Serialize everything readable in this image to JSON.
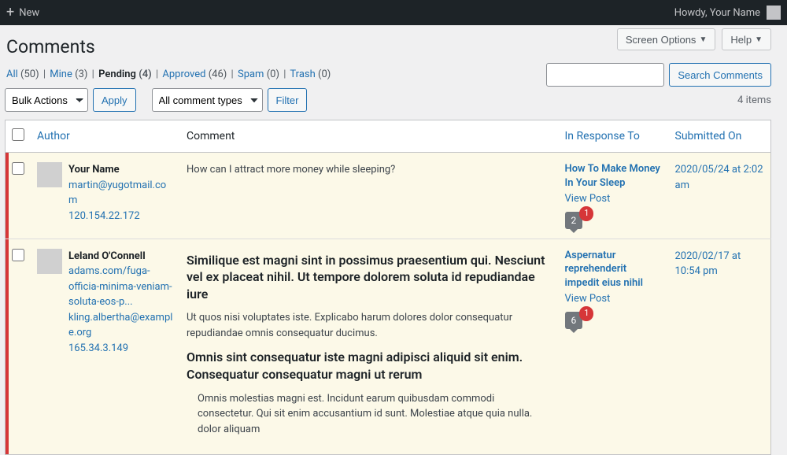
{
  "adminbar": {
    "new_label": "New",
    "howdy": "Howdy, Your Name"
  },
  "screen_options": "Screen Options",
  "help": "Help",
  "page_title": "Comments",
  "filters": {
    "all": {
      "label": "All",
      "count": "(50)"
    },
    "mine": {
      "label": "Mine",
      "count": "(3)"
    },
    "pending": {
      "label": "Pending",
      "count": "(4)"
    },
    "approved": {
      "label": "Approved",
      "count": "(46)"
    },
    "spam": {
      "label": "Spam",
      "count": "(0)"
    },
    "trash": {
      "label": "Trash",
      "count": "(0)"
    }
  },
  "bulk_select": "Bulk Actions",
  "apply": "Apply",
  "type_select": "All comment types",
  "filter_btn": "Filter",
  "search_btn": "Search Comments",
  "items_text": "4 items",
  "columns": {
    "author": "Author",
    "comment": "Comment",
    "response": "In Response To",
    "date": "Submitted On"
  },
  "rows": [
    {
      "author_name": "Your Name",
      "author_email": "martin@yugotmail.com",
      "author_url": "",
      "author_ip": "120.154.22.172",
      "comment_p1": "How can I attract more money while sleeping?",
      "post_title": "How To Make Money In Your Sleep",
      "view_post": "View Post",
      "bubble": "2",
      "badge": "1",
      "date": "2020/05/24 at 2:02 am"
    },
    {
      "author_name": "Leland O'Connell",
      "author_email": "kling.albertha@example.org",
      "author_url": "adams.com/fuga-officia-minima-veniam-soluta-eos-p...",
      "author_ip": "165.34.3.149",
      "comment_h1": "Similique est magni sint in possimus praesentium qui. Nesciunt vel ex placeat nihil. Ut tempore dolorem soluta id repudiandae iure",
      "comment_p1": "Ut quos nisi voluptates iste. Explicabo harum dolores dolor consequatur repudiandae omnis consequatur ducimus.",
      "comment_h2": "Omnis sint consequatur iste magni adipisci aliquid sit enim. Consequatur consequatur magni ut rerum",
      "comment_bq": "Omnis molestias magni est. Incidunt earum quibusdam commodi consectetur. Qui sit enim accusantium id sunt. Molestiae atque quia nulla. dolor aliquam",
      "post_title": "Aspernatur reprehenderit impedit eius nihil",
      "view_post": "View Post",
      "bubble": "6",
      "badge": "1",
      "date": "2020/02/17 at 10:54 pm"
    }
  ]
}
